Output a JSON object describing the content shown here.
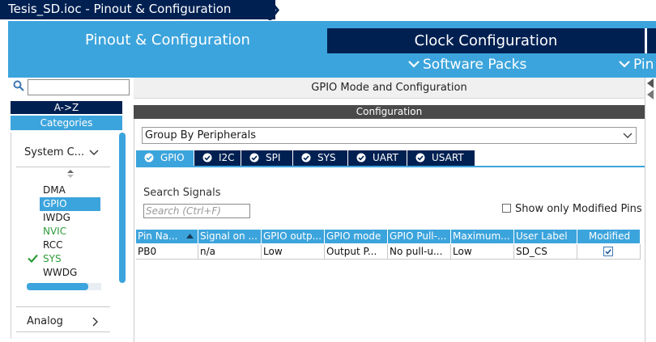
{
  "breadcrumb": {
    "file": "Tesis_SD.ioc - Pinout & Configuration"
  },
  "tabs": {
    "pinout": "Pinout & Configuration",
    "clock": "Clock Configuration",
    "software_packs": "Software Packs",
    "pinout_more": "Pin"
  },
  "left": {
    "sort_az": "A->Z",
    "categories": "Categories",
    "system_core": "System C...",
    "peripherals": [
      "DMA",
      "GPIO",
      "IWDG",
      "NVIC",
      "RCC",
      "SYS",
      "WWDG"
    ],
    "analog": "Analog"
  },
  "main": {
    "mode_header": "GPIO Mode and Configuration",
    "config_title": "Configuration",
    "group_by": "Group By Peripherals",
    "peripheral_tabs": [
      "GPIO",
      "I2C",
      "SPI",
      "SYS",
      "UART",
      "USART"
    ],
    "search_label": "Search Signals",
    "search_placeholder": "Search (Ctrl+F)",
    "show_modified": "Show only Modified Pins",
    "table": {
      "headers": [
        "Pin Na...",
        "Signal on ...",
        "GPIO outp...",
        "GPIO mode",
        "GPIO Pull-...",
        "Maximum...",
        "User Label",
        "Modified"
      ],
      "rows": [
        [
          "PB0",
          "n/a",
          "Low",
          "Output P...",
          "No pull-u...",
          "Low",
          "SD_CS",
          true
        ]
      ]
    }
  },
  "colors": {
    "navy": "#002052",
    "accent": "#3ca4dc",
    "active_green": "#2e9c3a"
  },
  "icons": [
    "search-icon",
    "chevron-down-icon",
    "chevron-right-icon",
    "check-icon",
    "sort-icon"
  ]
}
